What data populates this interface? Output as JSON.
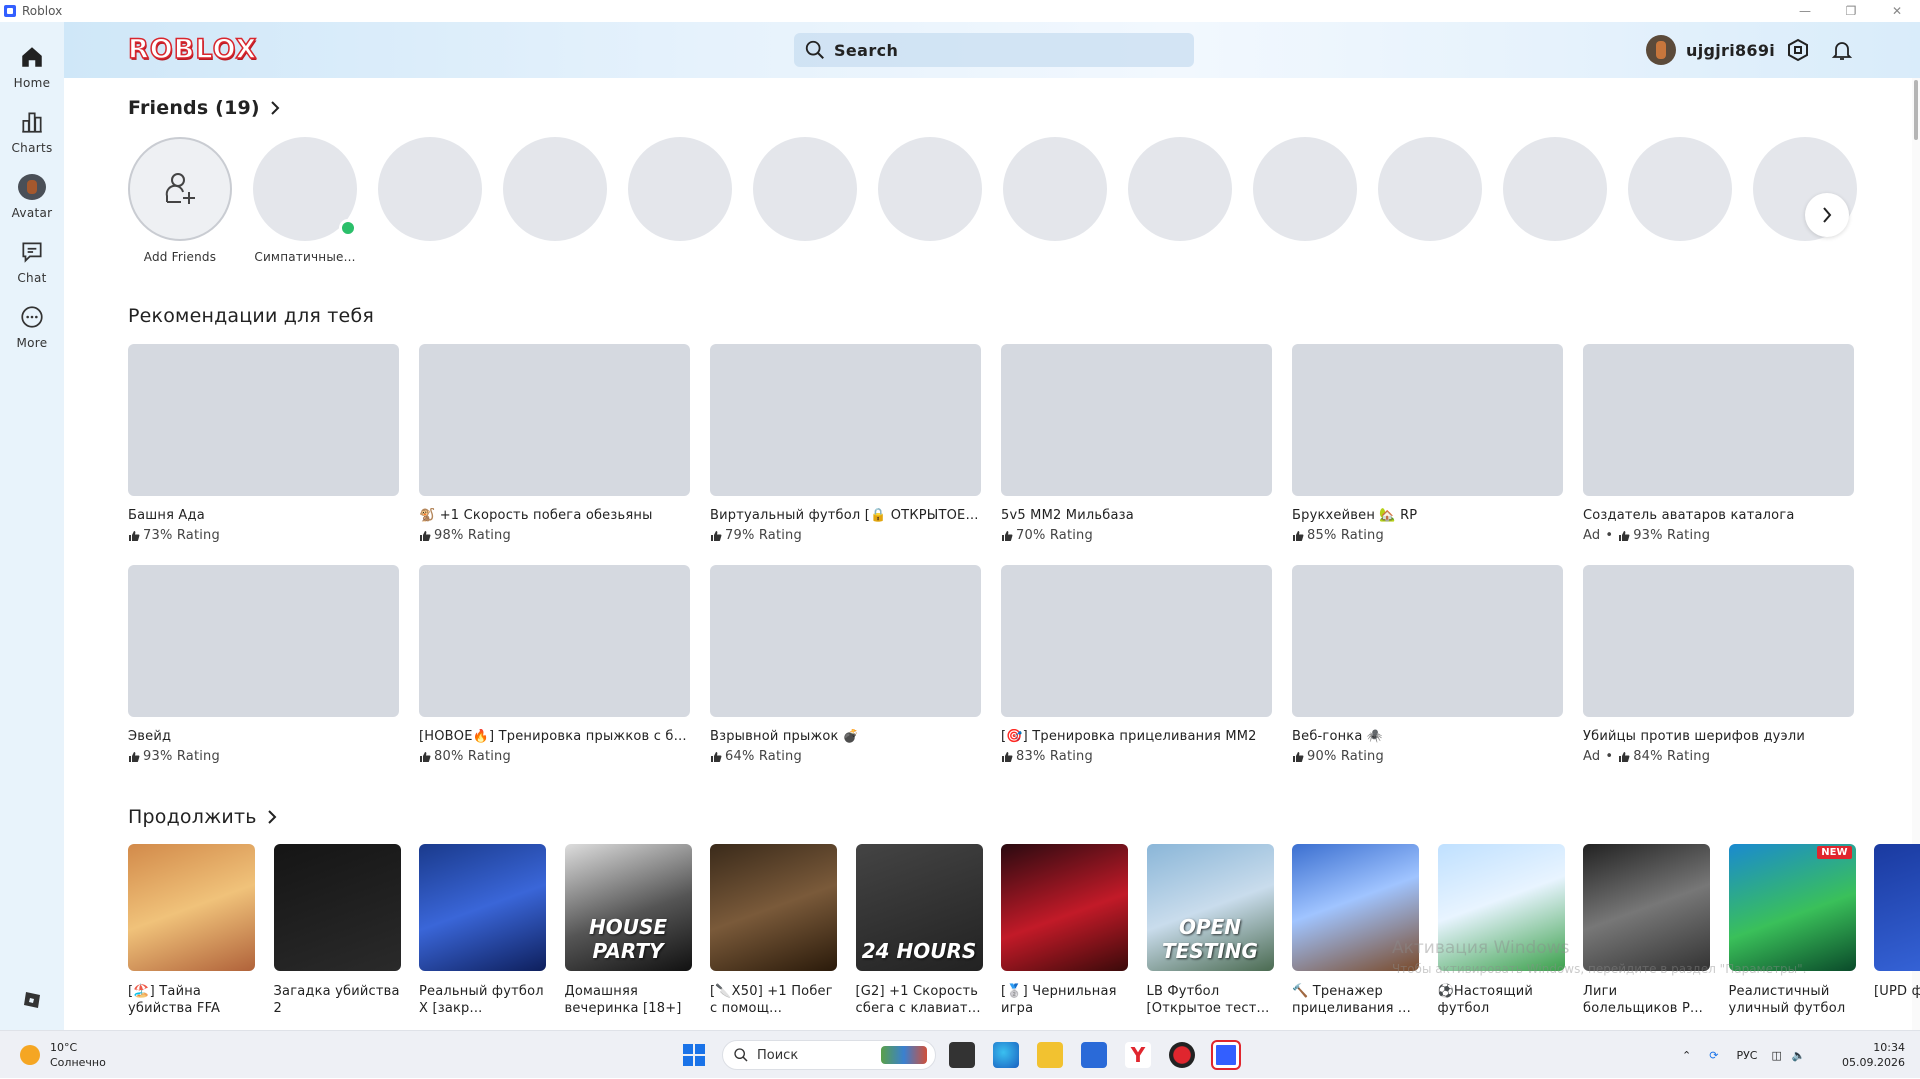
{
  "window": {
    "title": "Roblox",
    "controls": [
      "—",
      "❐",
      "✕"
    ]
  },
  "nav": {
    "items": [
      {
        "label": "Home",
        "icon": "home-icon"
      },
      {
        "label": "Charts",
        "icon": "charts-icon"
      },
      {
        "label": "Avatar",
        "icon": "avatar-icon"
      },
      {
        "label": "Chat",
        "icon": "chat-icon"
      },
      {
        "label": "More",
        "icon": "more-icon"
      }
    ]
  },
  "header": {
    "logo": "ROBLOX",
    "search_placeholder": "Search",
    "username": "ujgjri869i"
  },
  "friends": {
    "title": "Friends (19)",
    "add_label": "Add Friends",
    "first_friend": "Симпатичные...",
    "count_shown": 14
  },
  "recommended": {
    "title": "Рекомендации для тебя",
    "games": [
      {
        "title": "Башня Ада",
        "ad": false,
        "rating": "73% Rating"
      },
      {
        "title": "🐒 +1 Скорость побега обезьяны",
        "ad": false,
        "rating": "98% Rating"
      },
      {
        "title": "Виртуальный футбол [🔒 ОТКРЫТОЕ ТЕ...",
        "ad": false,
        "rating": "79% Rating"
      },
      {
        "title": "5v5 ММ2 Мильбаза",
        "ad": false,
        "rating": "70% Rating"
      },
      {
        "title": "Брукхейвен 🏡 RP",
        "ad": false,
        "rating": "85% Rating"
      },
      {
        "title": "Создатель аватаров каталога",
        "ad": true,
        "rating": "93% Rating"
      },
      {
        "title": "Эвейд",
        "ad": false,
        "rating": "93% Rating"
      },
      {
        "title": "[НОВОЕ🔥] Тренировка прыжков с бом...",
        "ad": false,
        "rating": "80% Rating"
      },
      {
        "title": "Взрывной прыжок 💣",
        "ad": false,
        "rating": "64% Rating"
      },
      {
        "title": "[🎯] Тренировка прицеливания ММ2",
        "ad": false,
        "rating": "83% Rating"
      },
      {
        "title": "Веб-гонка 🕷️",
        "ad": false,
        "rating": "90% Rating"
      },
      {
        "title": "Убийцы против шерифов дуэли",
        "ad": true,
        "rating": "84% Rating"
      }
    ],
    "ad_label": "Ad"
  },
  "continue": {
    "title": "Продолжить",
    "games": [
      {
        "title": "[🏖️] Тайна убийства FFA",
        "caption": "",
        "bg": "linear-gradient(160deg,#d28a4a,#f0c27a 50%,#b0623a)"
      },
      {
        "title": "Загадка убийства 2",
        "caption": "",
        "bg": "linear-gradient(160deg,#151515,#2a2a2a)"
      },
      {
        "title": "Реальный футбол X [закр...",
        "caption": "",
        "bg": "linear-gradient(160deg,#1a3a8c,#3a66d8 50%,#0e1f5c)"
      },
      {
        "title": "Домашняя вечеринка [18+]",
        "caption": "HOUSE PARTY",
        "bg": "linear-gradient(160deg,#ddd,#555 55%,#111)"
      },
      {
        "title": "[🔪X50] +1 Побег с помощ...",
        "caption": "",
        "bg": "linear-gradient(160deg,#3a2a1a,#7a5a3a 50%,#2a1a0a)"
      },
      {
        "title": "[G2] +1 Скорость сбега с клавиат...",
        "caption": "24 HOURS",
        "bg": "linear-gradient(160deg,#444,#222)"
      },
      {
        "title": "[🥈] Чернильная игра",
        "caption": "",
        "bg": "linear-gradient(160deg,#2a0a10,#c21a28 55%,#3a0a0a)"
      },
      {
        "title": "LB Футбол [Открытое тест...",
        "caption": "OPEN TESTING",
        "bg": "linear-gradient(160deg,#8ab6d8,#c9dcec 50%,#4a6a50)"
      },
      {
        "title": "🔨 Тренажер прицеливания ...",
        "caption": "",
        "bg": "linear-gradient(160deg,#3b6fd0,#a0c4ff 45%,#7a4a2a)"
      },
      {
        "title": "⚽Настоящий футбол",
        "caption": "",
        "bg": "linear-gradient(160deg,#bfe0ff,#e8f4ff 45%,#3aa04a)"
      },
      {
        "title": "Лиги болельщиков Р...",
        "caption": "",
        "bg": "linear-gradient(160deg,#222,#777 50%,#333)"
      },
      {
        "title": "Реалистичный уличный футбол",
        "caption": "",
        "bg": "linear-gradient(160deg,#1a8ad0,#3ac05a 55%,#0a4a2a)",
        "badge": "NEW"
      },
      {
        "title": "[UPD футбс",
        "caption": "",
        "bg": "linear-gradient(160deg,#1a3aa0,#3a6ae0)"
      }
    ]
  },
  "watermark": {
    "line1": "Активация Windows",
    "line2": "Чтобы активировать Windows, перейдите в раздел \"Параметры\"."
  },
  "taskbar": {
    "temperature": "10°C",
    "weather": "Солнечно",
    "search_placeholder": "Поиск",
    "language": "РУС",
    "time": "10:34",
    "date": "05.09.2026"
  },
  "colors": {
    "nav_bg": "#e8f3fb",
    "placeholder": "#d5d9e0",
    "online": "#2bbf6a",
    "logo_red": "#d8262e"
  }
}
